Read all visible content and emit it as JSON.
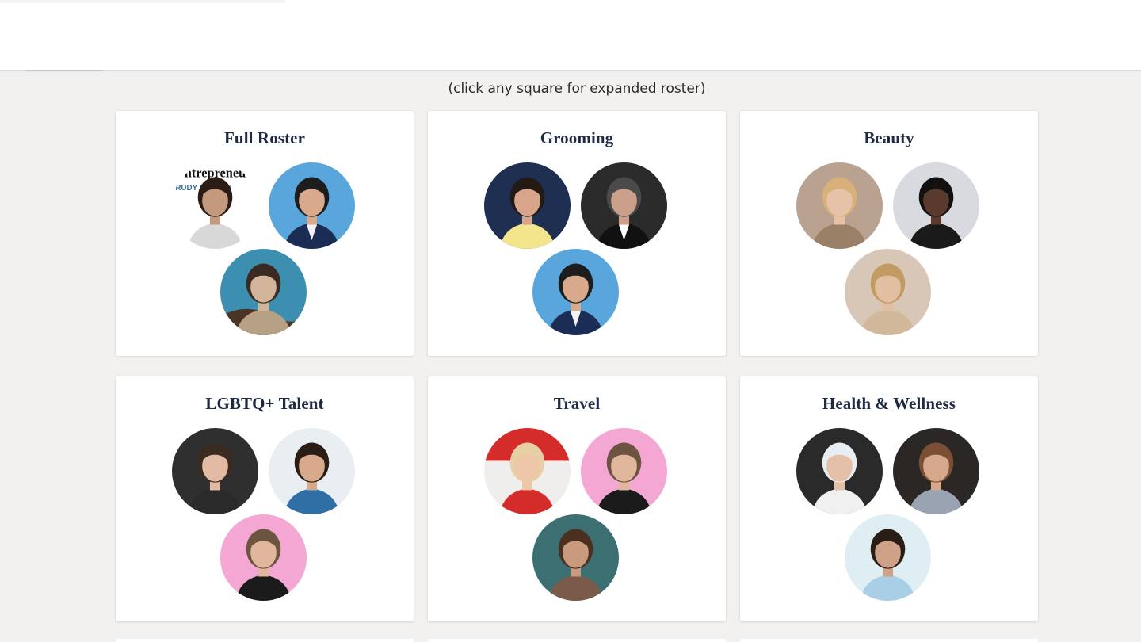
{
  "hint": "(click any square for expanded roster)",
  "categories": [
    {
      "title": "Full Roster",
      "avatars": [
        {
          "name": "magazine-cover-avatar",
          "bg": "#ffffff",
          "fg": "#3b6fa0",
          "skin": "#c49a7e",
          "hair": "#2b1d16",
          "cloth": "#d8d8d8",
          "magazine": "ntrepreneu",
          "cover_name": "RUDY BUNDINI"
        },
        {
          "name": "duo-blue-backdrop-avatar",
          "bg": "#59a6dd",
          "skin": "#d8a98b",
          "hair": "#1d1d1d",
          "cloth": "#1b2c55",
          "cloth2": "#f2f2f2"
        },
        {
          "name": "ocean-rock-avatar",
          "bg": "#3c8fb0",
          "skin": "#d2b49a",
          "hair": "#3a2a22",
          "cloth": "#b7a184",
          "rock": "#4a3426"
        }
      ]
    },
    {
      "title": "Grooming",
      "avatars": [
        {
          "name": "yellow-shirt-man-avatar",
          "bg": "#1f2f52",
          "skin": "#d9a58a",
          "hair": "#231a15",
          "cloth": "#f3e58c"
        },
        {
          "name": "tuxedo-man-avatar",
          "bg": "#2b2b2b",
          "skin": "#caa08a",
          "hair": "#4a4a4a",
          "cloth": "#111111",
          "cloth2": "#ffffff"
        },
        {
          "name": "duo-blue-backdrop-avatar",
          "bg": "#59a6dd",
          "skin": "#d8a98b",
          "hair": "#1d1d1d",
          "cloth": "#1b2c55",
          "cloth2": "#f2f2f2"
        }
      ]
    },
    {
      "title": "Beauty",
      "avatars": [
        {
          "name": "blonde-woman-avatar",
          "bg": "#b9a28f",
          "skin": "#e6c3a8",
          "hair": "#d9b07a",
          "cloth": "#9a8066"
        },
        {
          "name": "dark-hair-woman-avatar",
          "bg": "#d9dadf",
          "skin": "#5a3a2c",
          "hair": "#121010",
          "cloth": "#1a1a1a"
        },
        {
          "name": "honey-blonde-woman-avatar",
          "bg": "#d8c7b6",
          "skin": "#e2bfa0",
          "hair": "#c29a63",
          "cloth": "#d2b89a"
        }
      ]
    },
    {
      "title": "LGBTQ+ Talent",
      "avatars": [
        {
          "name": "studio-portrait-man-avatar",
          "bg": "#2f2f2f",
          "skin": "#e2b9a2",
          "hair": "#3a2a20",
          "cloth": "#2a2a2a"
        },
        {
          "name": "varsity-jacket-man-avatar",
          "bg": "#e9eef2",
          "skin": "#d8a98b",
          "hair": "#2a1d16",
          "cloth": "#2f6fa6"
        },
        {
          "name": "pink-backdrop-dog-avatar",
          "bg": "#f3a7d2",
          "skin": "#e0b79c",
          "hair": "#6b5440",
          "cloth": "#1b1b1b"
        }
      ]
    },
    {
      "title": "Travel",
      "avatars": [
        {
          "name": "red-dress-woman-avatar",
          "bg": "#f0eeec",
          "bg2": "#d42b2b",
          "skin": "#eec6a8",
          "hair": "#e6cfa4",
          "cloth": "#d42b2b"
        },
        {
          "name": "pink-backdrop-dog-avatar",
          "bg": "#f3a7d2",
          "skin": "#e0b79c",
          "hair": "#6b5440",
          "cloth": "#1b1b1b"
        },
        {
          "name": "teal-backdrop-woman-avatar",
          "bg": "#3c6f72",
          "skin": "#c99a7e",
          "hair": "#4b3020",
          "cloth": "#7a5a48"
        }
      ]
    },
    {
      "title": "Health & Wellness",
      "avatars": [
        {
          "name": "platinum-hair-man-avatar",
          "bg": "#2a2a2a",
          "skin": "#e4c0a8",
          "hair": "#e8edf2",
          "cloth": "#f0f0f0"
        },
        {
          "name": "knit-sweater-woman-avatar",
          "bg": "#2a2725",
          "skin": "#d6a98c",
          "hair": "#7a4f33",
          "cloth": "#9aa3b2"
        },
        {
          "name": "blue-shirt-man-avatar",
          "bg": "#dfeef2",
          "skin": "#cfa188",
          "hair": "#2a1d16",
          "cloth": "#a9cfe6"
        }
      ]
    }
  ]
}
